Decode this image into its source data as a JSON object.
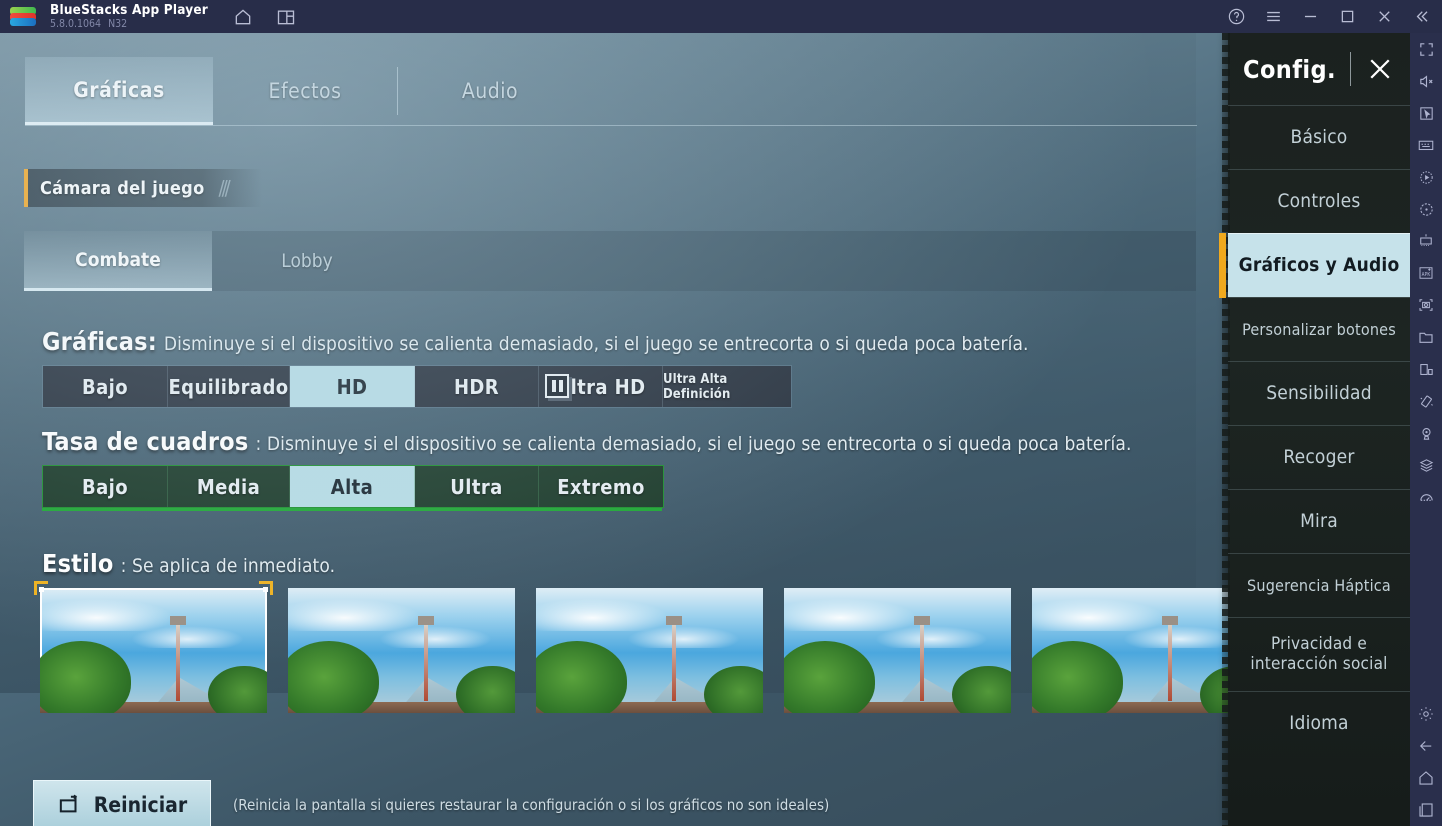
{
  "titlebar": {
    "app_name": "BlueStacks App Player",
    "version": "5.8.0.1064",
    "instance": "N32",
    "icons_left": [
      "home-icon",
      "multi-instance-icon"
    ],
    "icons_right": [
      "help-icon",
      "menu-icon",
      "minimize-icon",
      "maximize-icon",
      "close-icon",
      "collapse-icon"
    ]
  },
  "settings": {
    "top_tabs": [
      {
        "label": "Gráficas",
        "active": true
      },
      {
        "label": "Efectos",
        "active": false
      },
      {
        "label": "Audio",
        "active": false
      }
    ],
    "section_chip": "Cámara del juego",
    "sub_tabs": [
      {
        "label": "Combate",
        "active": true
      },
      {
        "label": "Lobby",
        "active": false
      }
    ],
    "graphics": {
      "label": "Gráficas:",
      "description": "Disminuye si el dispositivo se calienta demasiado, si el juego se entrecorta o si queda poca batería.",
      "options": [
        {
          "label": "Bajo",
          "selected": false
        },
        {
          "label": "Equilibrado",
          "selected": false
        },
        {
          "label": "HD",
          "selected": true
        },
        {
          "label": "HDR",
          "selected": false
        },
        {
          "label": "Ultra HD",
          "selected": false,
          "badge": "locked-badge-icon"
        },
        {
          "label": "Ultra Alta Definición",
          "selected": false
        }
      ]
    },
    "framerate": {
      "label": "Tasa de cuadros",
      "label_colon": ":",
      "description": "Disminuye si el dispositivo se calienta demasiado, si el juego se entrecorta o si queda poca batería.",
      "accent_color": "#1fa734",
      "options": [
        {
          "label": "Bajo",
          "selected": false
        },
        {
          "label": "Media",
          "selected": false
        },
        {
          "label": "Alta",
          "selected": true
        },
        {
          "label": "Ultra",
          "selected": false
        },
        {
          "label": "Extremo",
          "selected": false
        }
      ]
    },
    "style": {
      "label": "Estilo",
      "label_colon": ":",
      "description": "Se aplica de inmediato.",
      "thumbnails": [
        {
          "selected": true
        },
        {
          "selected": false
        },
        {
          "selected": false
        },
        {
          "selected": false
        },
        {
          "selected": false
        }
      ]
    },
    "reset": {
      "button_label": "Reiniciar",
      "button_icon": "restart-screen-icon",
      "note": "(Reinicia la pantalla si quieres restaurar la configuración o si los gráficos no son ideales)"
    }
  },
  "right_sidebar": {
    "title": "Config.",
    "close_icon": "close-icon",
    "accent_color": "#f0a91e",
    "active_bg": "#c6e2ea",
    "items": [
      {
        "label": "Básico",
        "active": false
      },
      {
        "label": "Controles",
        "active": false
      },
      {
        "label": "Gráficos y Audio",
        "active": true
      },
      {
        "label": "Personalizar botones",
        "active": false
      },
      {
        "label": "Sensibilidad",
        "active": false
      },
      {
        "label": "Recoger",
        "active": false
      },
      {
        "label": "Mira",
        "active": false
      },
      {
        "label": "Sugerencia Háptica",
        "active": false
      },
      {
        "label": "Privacidad e interacción social",
        "active": false
      },
      {
        "label": "Idioma",
        "active": false
      }
    ]
  },
  "bluestacks_toolbar": {
    "top_icons": [
      "fullscreen-icon",
      "mute-icon",
      "cursor-icon",
      "keyboard-controls-icon",
      "macro-record-icon",
      "rotate-icon",
      "multi-instance-sync-icon",
      "install-apk-icon",
      "screenshot-icon",
      "media-folder-icon",
      "multi-window-icon",
      "shake-icon",
      "location-icon",
      "layers-icon",
      "performance-icon"
    ],
    "bottom_icons": [
      "gear-icon",
      "back-arrow-icon",
      "home-icon",
      "recents-icon"
    ]
  }
}
